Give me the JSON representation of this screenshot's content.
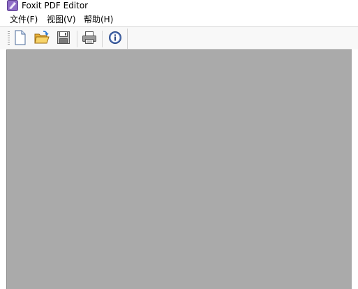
{
  "window": {
    "title": "Foxit PDF Editor",
    "accent_color": "#7d5fb0"
  },
  "menubar": {
    "items": [
      {
        "label": "文件(F)"
      },
      {
        "label": "视图(V)"
      },
      {
        "label": "帮助(H)"
      }
    ]
  },
  "toolbar": {
    "buttons": [
      {
        "icon": "new-document-icon"
      },
      {
        "icon": "open-folder-icon"
      },
      {
        "icon": "save-icon"
      },
      {
        "icon": "print-icon"
      },
      {
        "icon": "info-icon"
      }
    ]
  },
  "workspace": {
    "background": "#aaaaaa"
  }
}
